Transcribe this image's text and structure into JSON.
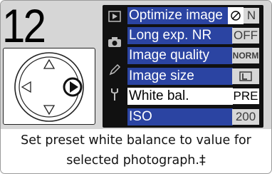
{
  "step_number": "12",
  "menu": {
    "rows": [
      {
        "label": "Optimize image",
        "value": "N",
        "value_icon": "no-symbol-icon"
      },
      {
        "label": "Long exp. NR",
        "value": "OFF"
      },
      {
        "label": "Image quality",
        "value": "NORM"
      },
      {
        "label": "Image size",
        "value": "",
        "value_icon": "image-size-large-icon"
      },
      {
        "label": "White bal.",
        "value": "PRE",
        "selected": true
      },
      {
        "label": "ISO",
        "value": "200"
      }
    ],
    "side_icons": [
      "playback-menu-icon",
      "shooting-menu-icon",
      "custom-settings-pencil-icon",
      "setup-wrench-icon"
    ]
  },
  "caption": {
    "line1": "Set preset white balance to value for",
    "line2": "selected photograph.‡"
  },
  "colors": {
    "highlight": "#2b44a2",
    "value_bg": "#d7d7d7",
    "panel_bg": "#d6d6d6"
  }
}
